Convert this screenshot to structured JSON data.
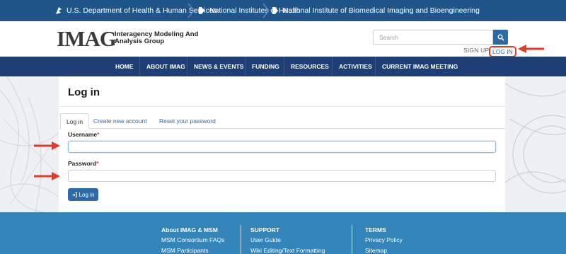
{
  "gov_bar": {
    "items": [
      {
        "label": "U.S. Department of Health & Human Services"
      },
      {
        "label": "National Institutes of Health"
      },
      {
        "label": "National Institute of Biomedical Imaging and Bioengineering"
      }
    ]
  },
  "header": {
    "logo_word": "IMAG",
    "logo_subtitle": "Interagency Modeling And Analysis Group",
    "search_placeholder": "Search",
    "search_icon": "search-icon",
    "signup_label": "SIGN UP",
    "login_label": "LOG IN"
  },
  "nav": {
    "items": [
      "HOME",
      "ABOUT IMAG",
      "NEWS & EVENTS",
      "FUNDING",
      "RESOURCES",
      "ACTIVITIES",
      "CURRENT IMAG MEETING"
    ]
  },
  "main": {
    "title": "Log in",
    "tabs": [
      {
        "label": "Log in",
        "active": true
      },
      {
        "label": "Create new account",
        "active": false
      },
      {
        "label": "Reset your password",
        "active": false
      }
    ],
    "username_label": "Username",
    "password_label": "Password",
    "required_marker": "*",
    "username_value": "",
    "password_value": "",
    "submit_label": "Log in",
    "submit_icon": "login-icon"
  },
  "footer": {
    "columns": [
      {
        "heading": "About IMAG & MSM",
        "links": [
          "MSM Consortium FAQs",
          "MSM Participants"
        ]
      },
      {
        "heading": "SUPPORT",
        "links": [
          "User Guide",
          "Wiki Editing/Text Formatting"
        ]
      },
      {
        "heading": "TERMS",
        "links": [
          "Privacy Policy",
          "Sitemap"
        ]
      }
    ]
  },
  "colors": {
    "gov_bar": "#20558a",
    "nav": "#1d3f76",
    "footer": "#3384b8",
    "link": "#2d6aa8",
    "annotation": "#e23b28"
  }
}
